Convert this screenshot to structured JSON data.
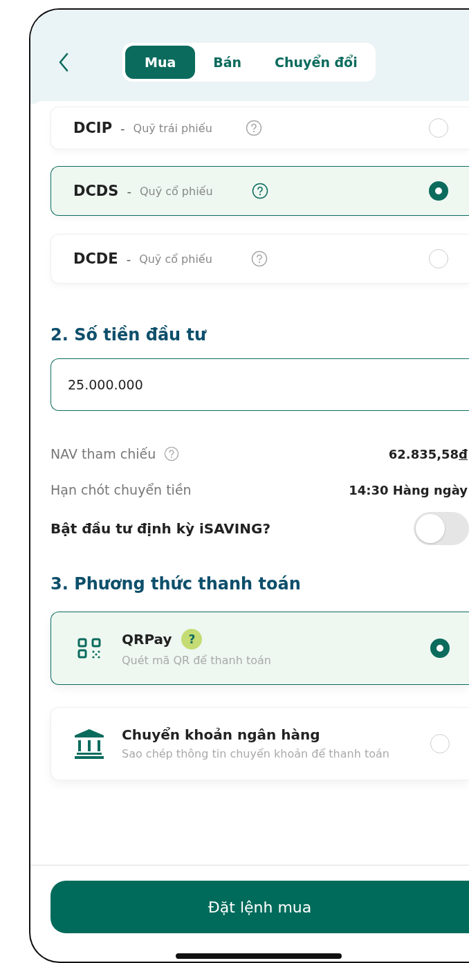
{
  "tabs": [
    {
      "label": "Mua",
      "selected": true
    },
    {
      "label": "Bán",
      "selected": false
    },
    {
      "label": "Chuyển đổi",
      "selected": false
    }
  ],
  "funds": [
    {
      "code": "DCIP",
      "separator": "-",
      "name": "Quỹ trái phiếu",
      "selected": false
    },
    {
      "code": "DCDS",
      "separator": "-",
      "name": "Quỹ cổ phiếu",
      "selected": true
    },
    {
      "code": "DCDE",
      "separator": "-",
      "name": "Quỹ cổ phiếu",
      "selected": false
    }
  ],
  "amount_section": {
    "title": "2. Số tiền đầu tư",
    "value": "25.000.000"
  },
  "info_rows": [
    {
      "label": "NAV tham chiếu",
      "help": true,
      "value": "62.835,58",
      "currency": "đ"
    },
    {
      "label": "Hạn chót chuyển tiền",
      "help": false,
      "value": "14:30 Hàng ngày"
    }
  ],
  "isaving": {
    "label": "Bật đầu tư định kỳ iSAVING?",
    "on": false
  },
  "payment_section": {
    "title": "3. Phương thức thanh toán"
  },
  "payment_methods": [
    {
      "kind": "qr",
      "title": "QRPay",
      "help": "?",
      "subtitle": "Quét mã QR để thanh toán",
      "selected": true
    },
    {
      "kind": "bank",
      "title": "Chuyển khoản ngân hàng",
      "subtitle": "Sao chép thông tin chuyển khoản để thanh toán",
      "selected": false
    }
  ],
  "submit": {
    "label": "Đặt lệnh mua"
  }
}
